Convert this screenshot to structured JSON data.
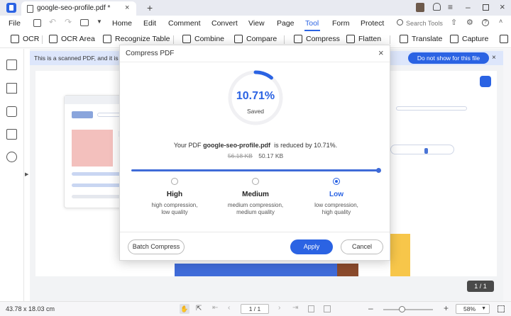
{
  "tab": {
    "title": "google-seo-profile.pdf *"
  },
  "menu": [
    "File",
    "Home",
    "Edit",
    "Comment",
    "Convert",
    "View",
    "Page",
    "Tool",
    "Form",
    "Protect"
  ],
  "search_tools": "Search Tools",
  "toolbar": {
    "ocr": "OCR",
    "ocr_area": "OCR Area",
    "recognize_table": "Recognize Table",
    "combine": "Combine",
    "compare": "Compare",
    "compress": "Compress",
    "flatten": "Flatten",
    "translate": "Translate",
    "capture": "Capture"
  },
  "banner": {
    "text": "This is a scanned PDF, and it is rec",
    "button": "Do not show for this file"
  },
  "dialog": {
    "title": "Compress PDF",
    "percent": "10.71%",
    "saved": "Saved",
    "info_prefix": "Your PDF",
    "filename": "google-seo-profile.pdf",
    "info_suffix": "is reduced by 10.71%.",
    "old_size": "56.18 KB",
    "new_size": "50.17 KB",
    "options": [
      {
        "label": "High",
        "desc1": "high compression,",
        "desc2": "low quality",
        "selected": false
      },
      {
        "label": "Medium",
        "desc1": "medium compression,",
        "desc2": "medium quality",
        "selected": false
      },
      {
        "label": "Low",
        "desc1": "low compression,",
        "desc2": "high quality",
        "selected": true
      }
    ],
    "batch": "Batch Compress",
    "apply": "Apply",
    "cancel": "Cancel"
  },
  "page_indicator": "1 / 1",
  "status": {
    "dimensions": "43.78 x 18.03 cm",
    "page_input": "1 / 1",
    "zoom": "58%"
  },
  "colors": {
    "accent": "#2b63e3"
  }
}
